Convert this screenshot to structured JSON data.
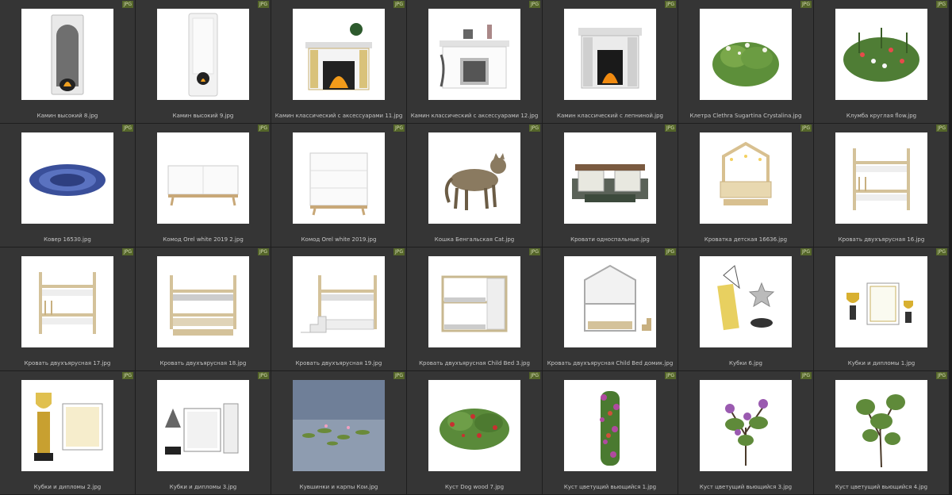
{
  "badge_label": "JPG",
  "files": [
    {
      "name": "Камин высокий 8.jpg",
      "icon": "fireplace-tall"
    },
    {
      "name": "Камин высокий 9.jpg",
      "icon": "fireplace-white-tall"
    },
    {
      "name": "Камин классический с аксессуарами 11.jpg",
      "icon": "fireplace-classic-gold"
    },
    {
      "name": "Камин классический с аксессуарами 12.jpg",
      "icon": "fireplace-classic-white"
    },
    {
      "name": "Камин классический с лепниной.jpg",
      "icon": "fireplace-stucco"
    },
    {
      "name": "Клетра Clethra Sugartina Crystalina.jpg",
      "icon": "shrub-flowering"
    },
    {
      "name": "Клумба круглая flow.jpg",
      "icon": "flowerbed-round"
    },
    {
      "name": "Ковер 16530.jpg",
      "icon": "rug-round"
    },
    {
      "name": "Комод Orel white 2019 2.jpg",
      "icon": "dresser-low"
    },
    {
      "name": "Комод Orel white 2019.jpg",
      "icon": "dresser-tall"
    },
    {
      "name": "Кошка Бенгальская Cat.jpg",
      "icon": "cat"
    },
    {
      "name": "Кровати односпальные.jpg",
      "icon": "beds-single"
    },
    {
      "name": "Кроватка детская 16636.jpg",
      "icon": "kids-bed"
    },
    {
      "name": "Кровать двухъярусная 16.jpg",
      "icon": "bunk-bed"
    },
    {
      "name": "Кровать двухъярусная 17.jpg",
      "icon": "bunk-bed"
    },
    {
      "name": "Кровать двухъярусная 18.jpg",
      "icon": "bunk-bed-drawers"
    },
    {
      "name": "Кровать двухъярусная 19.jpg",
      "icon": "bunk-bed-stairs"
    },
    {
      "name": "Кровать двухъярусная Child Bed 3.jpg",
      "icon": "bunk-bed-cabin"
    },
    {
      "name": "Кровать двухъярусная Child Bed домик.jpg",
      "icon": "bunk-bed-house"
    },
    {
      "name": "Кубки 6.jpg",
      "icon": "trophies"
    },
    {
      "name": "Кубки и дипломы 1.jpg",
      "icon": "trophies-diplomas"
    },
    {
      "name": "Кубки и дипломы 2.jpg",
      "icon": "trophy-diploma"
    },
    {
      "name": "Кубки и дипломы 3.jpg",
      "icon": "awards-diplomas"
    },
    {
      "name": "Кувшинки и карпы Кои.jpg",
      "icon": "water-lilies"
    },
    {
      "name": "Куст Dog wood 7.jpg",
      "icon": "bush-dogwood"
    },
    {
      "name": "Куст цветущий вьющийся 1.jpg",
      "icon": "vine-flowering"
    },
    {
      "name": "Куст цветущий вьющийся 3.jpg",
      "icon": "vine-lilac"
    },
    {
      "name": "Куст цветущий вьющийся 4.jpg",
      "icon": "vine-green"
    }
  ]
}
